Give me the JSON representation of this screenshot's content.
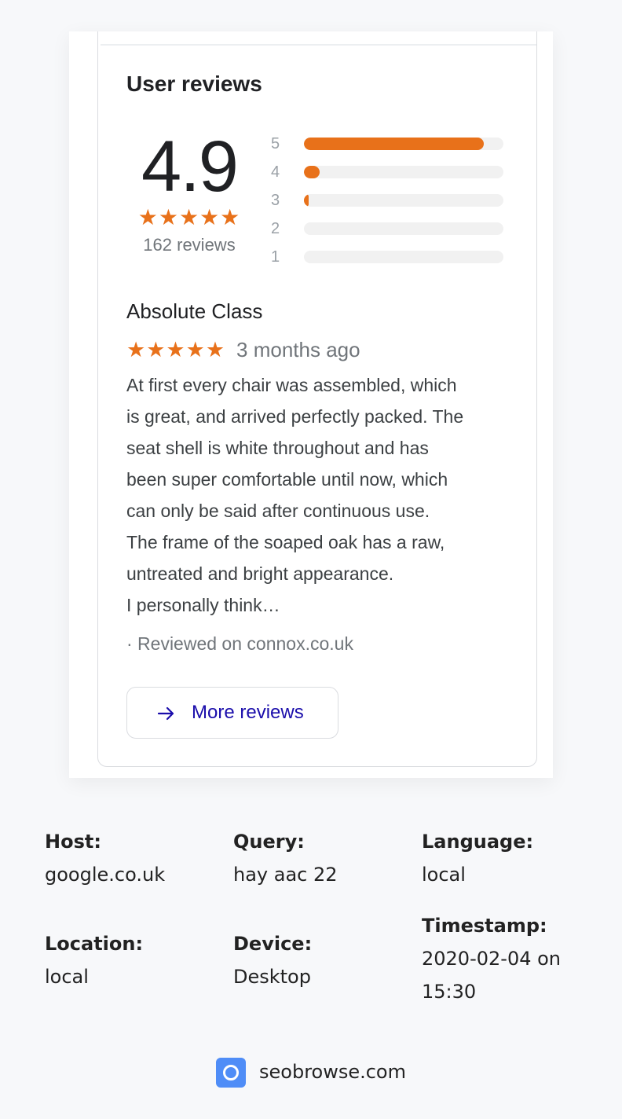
{
  "reviews_panel": {
    "title": "User reviews",
    "rating": "4.9",
    "stars": "★★★★★",
    "review_count": "162 reviews",
    "distribution": [
      {
        "label": "5",
        "fraction": 0.9
      },
      {
        "label": "4",
        "fraction": 0.08
      },
      {
        "label": "3",
        "fraction": 0.02
      },
      {
        "label": "2",
        "fraction": 0.0
      },
      {
        "label": "1",
        "fraction": 0.0
      }
    ],
    "review": {
      "title": "Absolute Class",
      "stars": "★★★★★",
      "date": "3 months ago",
      "body_lines": [
        "At first every chair was assembled, which",
        "is great, and arrived perfectly packed. The",
        "seat shell is white throughout and has",
        "been super comfortable until now, which",
        "can only be said after continuous use.",
        "The frame of the soaped oak has a raw,",
        "untreated and bright appearance.",
        "I personally think…"
      ],
      "source": "· Reviewed on connox.co.uk"
    },
    "more_button": {
      "label": "More reviews",
      "icon": "arrow-right-icon"
    }
  },
  "metadata": {
    "host": {
      "label": "Host:",
      "value": "google.co.uk"
    },
    "query": {
      "label": "Query:",
      "value": "hay aac 22"
    },
    "language": {
      "label": "Language:",
      "value": "local"
    },
    "location": {
      "label": "Location:",
      "value": "local"
    },
    "device": {
      "label": "Device:",
      "value": "Desktop"
    },
    "timestamp": {
      "label": "Timestamp:",
      "value_lines": [
        "2020-02-04 on",
        "15:30"
      ]
    }
  },
  "footer": {
    "brand_name": "seobrowse.com",
    "logo_icon": "seobrowse-logo-icon"
  },
  "colors": {
    "accent_orange": "#e8711a",
    "link_blue": "#1a0dab",
    "track_gray": "#f1f1f1"
  }
}
